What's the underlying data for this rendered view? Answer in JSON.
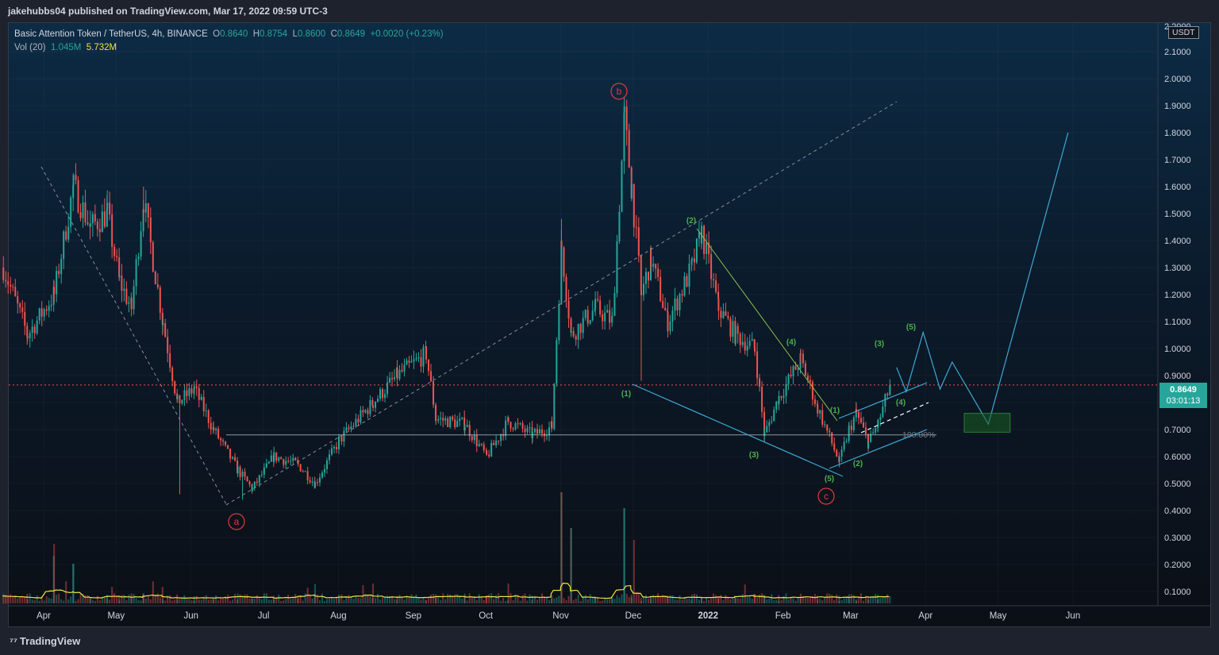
{
  "header": {
    "published_line": "jakehubbs04 published on TradingView.com, Mar 17, 2022 09:59 UTC-3"
  },
  "legend": {
    "symbol": "Basic Attention Token / TetherUS, 4h, BINANCE",
    "o_label": "O",
    "o_val": "0.8640",
    "h_label": "H",
    "h_val": "0.8754",
    "l_label": "L",
    "l_val": "0.8600",
    "c_label": "C",
    "c_val": "0.8649",
    "change": "+0.0020 (+0.23%)",
    "vol_label": "Vol (20)",
    "vol_val": "1.045M",
    "vol_ma": "5.732M"
  },
  "price_scale": {
    "currency": "USDT",
    "ticks": [
      "2.1000",
      "2.0000",
      "1.9000",
      "1.8000",
      "1.7000",
      "1.6000",
      "1.5000",
      "1.4000",
      "1.3000",
      "1.2000",
      "1.1000",
      "1.0000",
      "0.9000",
      "0.8000",
      "0.7000",
      "0.6000",
      "0.5000",
      "0.4000",
      "0.3000",
      "0.2000",
      "0.1000"
    ],
    "top_partial": "2.2000",
    "current_price": "0.8649",
    "countdown": "03:01:13"
  },
  "time_axis": {
    "labels": [
      "Apr",
      "May",
      "Jun",
      "Jul",
      "Aug",
      "Sep",
      "Oct",
      "Nov",
      "Dec",
      "2022",
      "Feb",
      "Mar",
      "Apr",
      "May",
      "Jun"
    ]
  },
  "annotations": {
    "wave_a": "a",
    "wave_b": "b",
    "wave_c": "c",
    "sub_1": "(1)",
    "sub_2": "(2)",
    "sub_3": "(3)",
    "sub_4": "(4)",
    "sub_5": "(5)",
    "micro_1": "(1)",
    "micro_2": "(2)",
    "micro_3": "(3)",
    "micro_4": "(4)",
    "micro_5": "(5)",
    "fib_label": "100.00%"
  },
  "footer": {
    "brand": "TradingView"
  },
  "colors": {
    "up": "#26a69a",
    "down": "#ef5350",
    "wave_red": "#e53935",
    "wave_green": "#4caf50",
    "projection": "#3fa9d4",
    "volume_ma": "#f0e442"
  },
  "chart_data": {
    "type": "candlestick",
    "title": "Basic Attention Token / TetherUS, 4h, BINANCE",
    "ylim": [
      0.05,
      2.2
    ],
    "y_ticks": [
      0.1,
      0.2,
      0.3,
      0.4,
      0.5,
      0.6,
      0.7,
      0.8,
      0.9,
      1.0,
      1.1,
      1.2,
      1.3,
      1.4,
      1.5,
      1.6,
      1.7,
      1.8,
      1.9,
      2.0,
      2.1
    ],
    "x_labels": [
      "Apr",
      "May",
      "Jun",
      "Jul",
      "Aug",
      "Sep",
      "Oct",
      "Nov",
      "Dec",
      "2022",
      "Feb",
      "Mar",
      "Apr",
      "May",
      "Jun"
    ],
    "price_path": [
      [
        "2021-03-15",
        1.3
      ],
      [
        "2021-03-25",
        1.05
      ],
      [
        "2021-04-05",
        1.2
      ],
      [
        "2021-04-13",
        1.6
      ],
      [
        "2021-04-20",
        1.45
      ],
      [
        "2021-04-27",
        1.5
      ],
      [
        "2021-05-02",
        1.25
      ],
      [
        "2021-05-07",
        1.15
      ],
      [
        "2021-05-12",
        1.55
      ],
      [
        "2021-05-20",
        1.1
      ],
      [
        "2021-05-26",
        0.8
      ],
      [
        "2021-06-02",
        0.85
      ],
      [
        "2021-06-10",
        0.7
      ],
      [
        "2021-06-20",
        0.55
      ],
      [
        "2021-06-26",
        0.48
      ],
      [
        "2021-07-05",
        0.6
      ],
      [
        "2021-07-15",
        0.57
      ],
      [
        "2021-07-22",
        0.5
      ],
      [
        "2021-08-01",
        0.66
      ],
      [
        "2021-08-15",
        0.8
      ],
      [
        "2021-08-25",
        0.9
      ],
      [
        "2021-09-06",
        0.98
      ],
      [
        "2021-09-10",
        0.74
      ],
      [
        "2021-09-22",
        0.72
      ],
      [
        "2021-10-01",
        0.6
      ],
      [
        "2021-10-10",
        0.73
      ],
      [
        "2021-10-20",
        0.68
      ],
      [
        "2021-10-28",
        0.71
      ],
      [
        "2021-11-01",
        1.38
      ],
      [
        "2021-11-05",
        1.05
      ],
      [
        "2021-11-15",
        1.15
      ],
      [
        "2021-11-22",
        1.1
      ],
      [
        "2021-11-27",
        1.85
      ],
      [
        "2021-11-30",
        1.6
      ],
      [
        "2021-12-04",
        1.2
      ],
      [
        "2021-12-08",
        1.33
      ],
      [
        "2021-12-15",
        1.1
      ],
      [
        "2021-12-25",
        1.3
      ],
      [
        "2021-12-29",
        1.43
      ],
      [
        "2022-01-05",
        1.15
      ],
      [
        "2022-01-12",
        1.05
      ],
      [
        "2022-01-20",
        1.0
      ],
      [
        "2022-01-24",
        0.68
      ],
      [
        "2022-01-30",
        0.82
      ],
      [
        "2022-02-08",
        0.96
      ],
      [
        "2022-02-15",
        0.78
      ],
      [
        "2022-02-24",
        0.58
      ],
      [
        "2022-02-28",
        0.7
      ],
      [
        "2022-03-03",
        0.76
      ],
      [
        "2022-03-08",
        0.65
      ],
      [
        "2022-03-12",
        0.72
      ],
      [
        "2022-03-17",
        0.8649
      ]
    ],
    "pivots": {
      "a": {
        "date": "2021-06-22",
        "price": 0.45
      },
      "b": {
        "date": "2021-11-28",
        "price": 1.92
      },
      "c": {
        "date": "2022-02-24",
        "price": 0.56
      }
    },
    "horizontal_level": {
      "price": 0.68,
      "label": "100.00%"
    },
    "current_price": 0.8649,
    "projection_path": [
      [
        "2022-03-20",
        0.93
      ],
      [
        "2022-03-24",
        0.84
      ],
      [
        "2022-03-31",
        1.06
      ],
      [
        "2022-04-07",
        0.85
      ],
      [
        "2022-04-12",
        0.95
      ],
      [
        "2022-04-27",
        0.72
      ],
      [
        "2022-05-30",
        1.8
      ]
    ],
    "target_box": {
      "x0": "2022-04-17",
      "x1": "2022-05-06",
      "y0": 0.69,
      "y1": 0.76
    }
  }
}
